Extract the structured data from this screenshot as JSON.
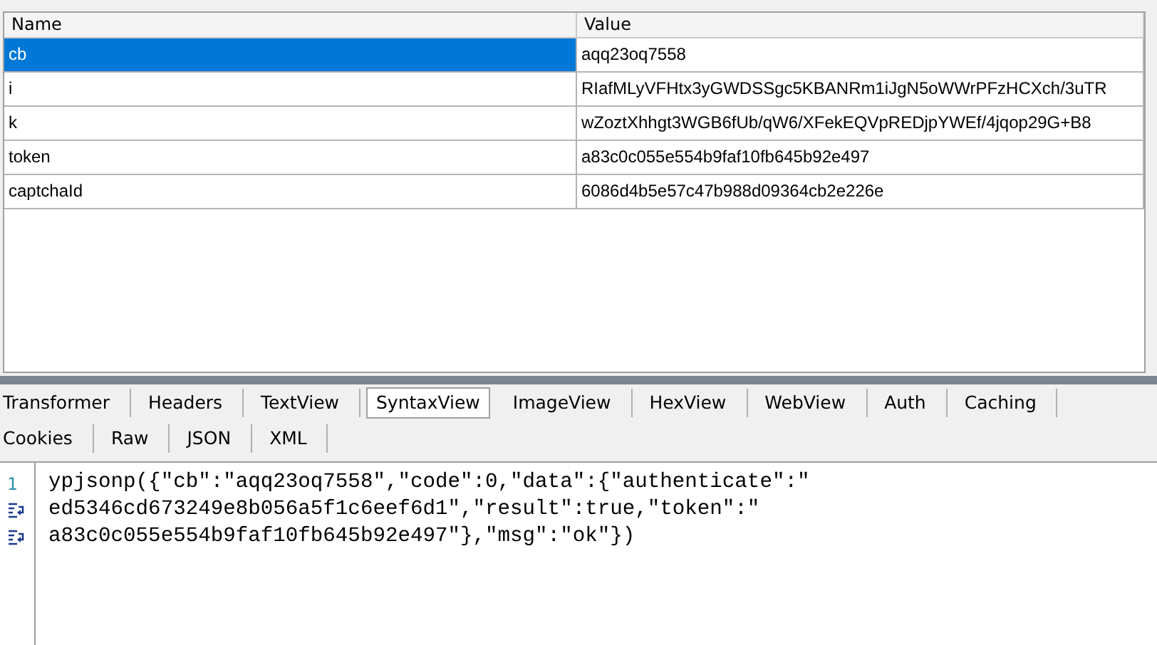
{
  "query_table": {
    "columns": [
      "Name",
      "Value"
    ],
    "rows": [
      {
        "name": "cb",
        "value": "aqq23oq7558",
        "selected": true
      },
      {
        "name": "i",
        "value": "RIafMLyVFHtx3yGWDSSgc5KBANRm1iJgN5oWWrPFzHCXch/3uTR",
        "selected": false
      },
      {
        "name": "k",
        "value": "wZoztXhhgt3WGB6fUb/qW6/XFekEQVpREDjpYWEf/4jqop29G+B8",
        "selected": false
      },
      {
        "name": "token",
        "value": "a83c0c055e554b9faf10fb645b92e497",
        "selected": false
      },
      {
        "name": "captchaId",
        "value": "6086d4b5e57c47b988d09364cb2e226e",
        "selected": false
      }
    ]
  },
  "tab_rows": [
    [
      {
        "label": "Transformer",
        "selected": false
      },
      {
        "label": "Headers",
        "selected": false
      },
      {
        "label": "TextView",
        "selected": false
      },
      {
        "label": "SyntaxView",
        "selected": true
      },
      {
        "label": "ImageView",
        "selected": false
      },
      {
        "label": "HexView",
        "selected": false
      },
      {
        "label": "WebView",
        "selected": false
      },
      {
        "label": "Auth",
        "selected": false
      },
      {
        "label": "Caching",
        "selected": false
      }
    ],
    [
      {
        "label": "Cookies",
        "selected": false
      },
      {
        "label": "Raw",
        "selected": false
      },
      {
        "label": "JSON",
        "selected": false
      },
      {
        "label": "XML",
        "selected": false
      }
    ]
  ],
  "code_lines": [
    {
      "kind": "numbered",
      "number": "1",
      "text": "ypjsonp({\"cb\":\"aqq23oq7558\",\"code\":0,\"data\":{\"authenticate\":\""
    },
    {
      "kind": "wrapped",
      "text": "ed5346cd673249e8b056a5f1c6eef6d1\",\"result\":true,\"token\":\""
    },
    {
      "kind": "wrapped",
      "text": "a83c0c055e554b9faf10fb645b92e497\"},\"msg\":\"ok\"})"
    }
  ]
}
